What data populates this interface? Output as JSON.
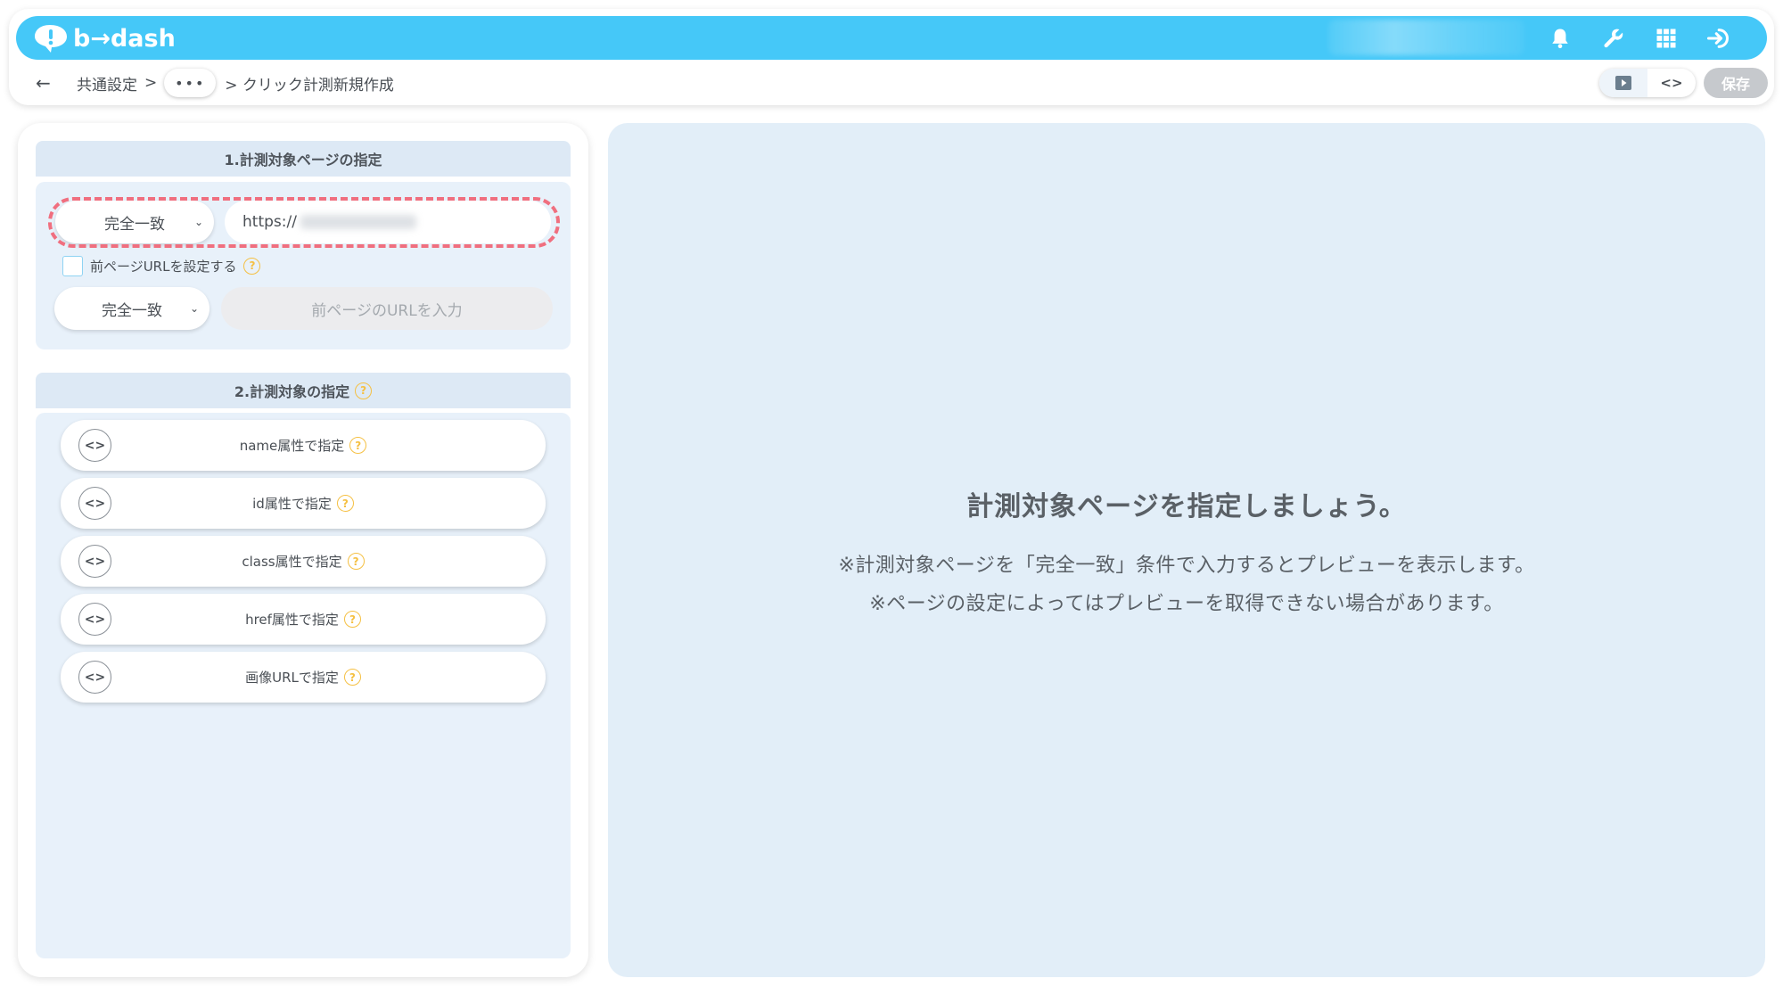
{
  "app": {
    "logo_text": "b→dash",
    "brand_color": "#45c8f8"
  },
  "header": {
    "icons": [
      "bell-icon",
      "wrench-icon",
      "apps-grid-icon",
      "logout-icon"
    ]
  },
  "breadcrumb": {
    "back_label": "←",
    "root": "共通設定",
    "separator": ">",
    "more_label": "•••",
    "current": "> クリック計測新規作成"
  },
  "toolbar": {
    "save_label": "保存"
  },
  "section1": {
    "title": "1.計測対象ページの指定",
    "match_select": "完全一致",
    "url_value": "https://",
    "checkbox_label": "前ページURLを設定する",
    "prev_match_select": "完全一致",
    "prev_url_placeholder": "前ページのURLを入力",
    "highlight_color": "#f06f7f"
  },
  "section2": {
    "title": "2.計測対象の指定",
    "options": [
      {
        "label": "name属性で指定"
      },
      {
        "label": "id属性で指定"
      },
      {
        "label": "class属性で指定"
      },
      {
        "label": "href属性で指定"
      },
      {
        "label": "画像URLで指定"
      }
    ]
  },
  "preview": {
    "title": "計測対象ページを指定しましょう。",
    "note1": "※計測対象ページを「完全一致」条件で入力するとプレビューを表示します。",
    "note2": "※ページの設定によってはプレビューを取得できない場合があります。"
  },
  "common": {
    "help_mark": "?",
    "code_icon_glyph": "<>",
    "chevron_glyph": "⌄"
  }
}
